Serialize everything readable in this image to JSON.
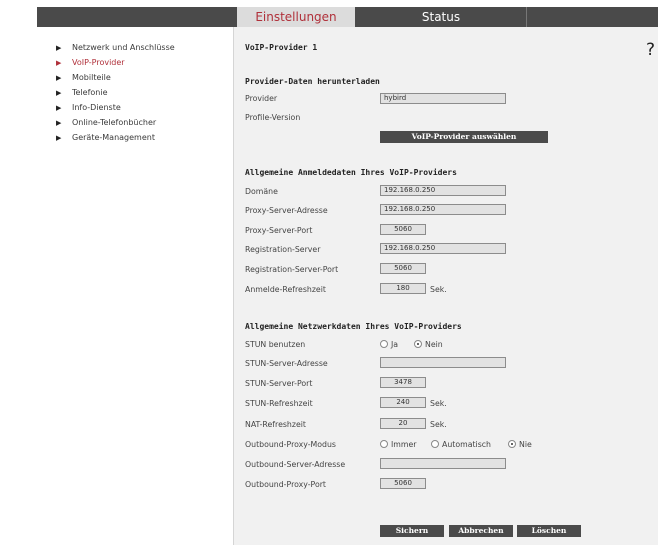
{
  "tabs": {
    "settings": "Einstellungen",
    "status": "Status"
  },
  "help_label": "?",
  "sidebar": {
    "items": [
      {
        "label": "Netzwerk und Anschlüsse",
        "active": false
      },
      {
        "label": "VoIP-Provider",
        "active": true
      },
      {
        "label": "Mobilteile",
        "active": false
      },
      {
        "label": "Telefonie",
        "active": false
      },
      {
        "label": "Info-Dienste",
        "active": false
      },
      {
        "label": "Online-Telefonbücher",
        "active": false
      },
      {
        "label": "Geräte-Management",
        "active": false
      }
    ]
  },
  "page_title": "VoIP-Provider 1",
  "provider_download": {
    "heading": "Provider-Daten herunterladen",
    "provider_label": "Provider",
    "provider_value": "hybird",
    "profile_version_label": "Profile-Version",
    "select_button": "VoIP-Provider auswählen"
  },
  "login": {
    "heading": "Allgemeine Anmeldedaten Ihres VoIP-Providers",
    "domain_label": "Domäne",
    "domain_value": "192.168.0.250",
    "proxy_address_label": "Proxy-Server-Adresse",
    "proxy_address_value": "192.168.0.250",
    "proxy_port_label": "Proxy-Server-Port",
    "proxy_port_value": "5060",
    "registrar_label": "Registration-Server",
    "registrar_value": "192.168.0.250",
    "registrar_port_label": "Registration-Server-Port",
    "registrar_port_value": "5060",
    "refresh_label": "Anmelde-Refreshzeit",
    "refresh_value": "180",
    "refresh_unit": "Sek."
  },
  "network": {
    "heading": "Allgemeine Netzwerkdaten Ihres VoIP-Providers",
    "stun_use_label": "STUN benutzen",
    "stun_yes": "Ja",
    "stun_no": "Nein",
    "stun_selected": "Nein",
    "stun_address_label": "STUN-Server-Adresse",
    "stun_address_value": "",
    "stun_port_label": "STUN-Server-Port",
    "stun_port_value": "3478",
    "stun_refresh_label": "STUN-Refreshzeit",
    "stun_refresh_value": "240",
    "stun_refresh_unit": "Sek.",
    "nat_refresh_label": "NAT-Refreshzeit",
    "nat_refresh_value": "20",
    "nat_refresh_unit": "Sek.",
    "outbound_mode_label": "Outbound-Proxy-Modus",
    "mode_always": "Immer",
    "mode_auto": "Automatisch",
    "mode_never": "Nie",
    "mode_selected": "Nie",
    "outbound_address_label": "Outbound-Server-Adresse",
    "outbound_address_value": "",
    "outbound_port_label": "Outbound-Proxy-Port",
    "outbound_port_value": "5060"
  },
  "actions": {
    "save": "Sichern",
    "cancel": "Abbrechen",
    "delete": "Löschen"
  },
  "colors": {
    "accent": "#b0303a",
    "header_bg": "#4a4a4a",
    "button_bg": "#4b4b4b",
    "content_bg": "#f1f1f1"
  }
}
